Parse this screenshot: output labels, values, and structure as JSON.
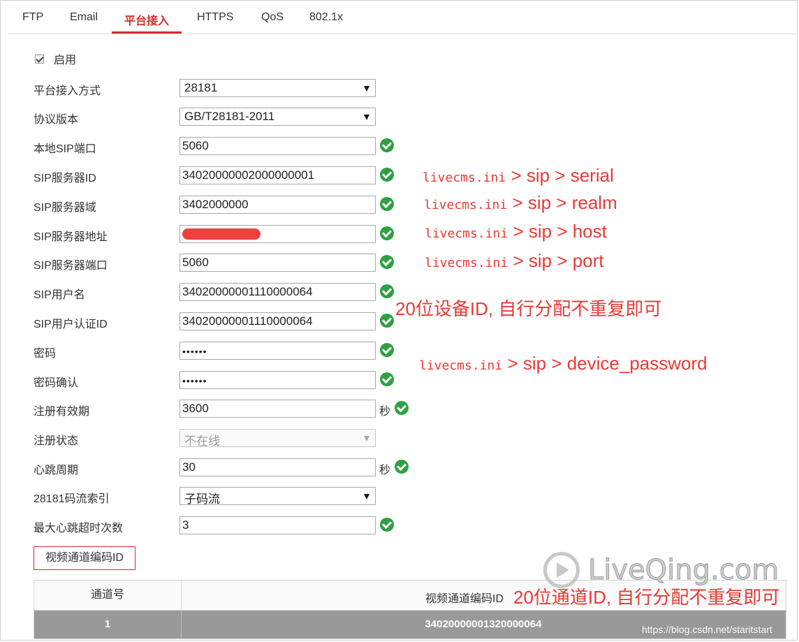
{
  "tabs": [
    "FTP",
    "Email",
    "平台接入",
    "HTTPS",
    "QoS",
    "802.1x"
  ],
  "active_tab": "平台接入",
  "enable": {
    "label": "启用",
    "checked": true
  },
  "form": {
    "access_mode": {
      "label": "平台接入方式",
      "value": "28181"
    },
    "protocol_version": {
      "label": "协议版本",
      "value": "GB/T28181-2011"
    },
    "local_sip_port": {
      "label": "本地SIP端口",
      "value": "5060"
    },
    "sip_server_id": {
      "label": "SIP服务器ID",
      "value": "34020000002000000001"
    },
    "sip_server_domain": {
      "label": "SIP服务器域",
      "value": "3402000000"
    },
    "sip_server_address": {
      "label": "SIP服务器地址",
      "value": ""
    },
    "sip_server_port": {
      "label": "SIP服务器端口",
      "value": "5060"
    },
    "sip_username": {
      "label": "SIP用户名",
      "value": "34020000001110000064"
    },
    "sip_auth_id": {
      "label": "SIP用户认证ID",
      "value": "34020000001110000064"
    },
    "password": {
      "label": "密码",
      "value": "••••••"
    },
    "password_confirm": {
      "label": "密码确认",
      "value": "••••••"
    },
    "register_validity": {
      "label": "注册有效期",
      "value": "3600",
      "unit": "秒"
    },
    "register_status": {
      "label": "注册状态",
      "value": "不在线"
    },
    "heartbeat_period": {
      "label": "心跳周期",
      "value": "30",
      "unit": "秒"
    },
    "stream_index": {
      "label": "28181码流索引",
      "value": "子码流"
    },
    "max_heartbeat_timeout": {
      "label": "最大心跳超时次数",
      "value": "3"
    }
  },
  "annotations": {
    "serial": {
      "prefix": "livecms.ini",
      "path": " > sip > serial"
    },
    "realm": {
      "prefix": "livecms.ini",
      "path": " > sip > realm"
    },
    "host": {
      "prefix": "livecms.ini",
      "path": " > sip > host"
    },
    "port": {
      "prefix": "livecms.ini",
      "path": " > sip > port"
    },
    "device_id_note": "20位设备ID, 自行分配不重复即可",
    "password": {
      "prefix": "livecms.ini",
      "path": " > sip > device_password"
    },
    "channel_id_note": "20位通道ID, 自行分配不重复即可"
  },
  "channel_button": "视频通道编码ID",
  "table": {
    "headers": [
      "通道号",
      "视频通道编码ID"
    ],
    "rows": [
      {
        "channel": "1",
        "code": "34020000001320000064"
      }
    ]
  },
  "watermarks": {
    "logo": "LiveQing.com",
    "url": "https://blog.csdn.net/staritstart"
  },
  "colors": {
    "accent": "#d52b2b",
    "annotation": "#e83a35",
    "ok": "#2fa043",
    "table_row": "#999999"
  }
}
